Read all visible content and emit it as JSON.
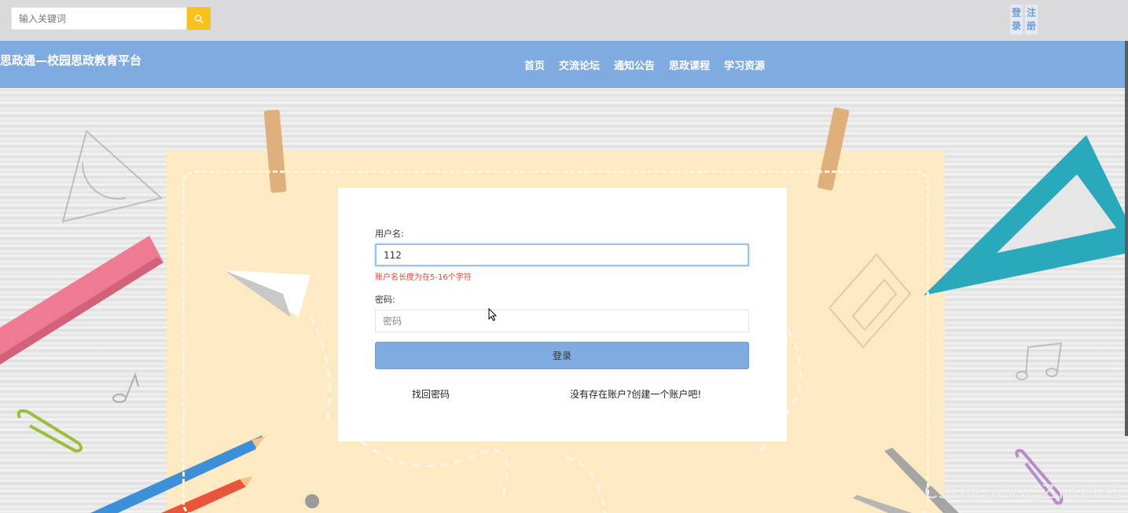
{
  "search": {
    "placeholder": "输入关键词",
    "icon": "search-icon"
  },
  "auth": {
    "login": [
      "登",
      "录"
    ],
    "register": [
      "注",
      "册"
    ]
  },
  "nav": {
    "site_title": "思政通—校园思政教育平台",
    "items": [
      "首页",
      "交流论坛",
      "通知公告",
      "思政课程",
      "学习资源"
    ]
  },
  "form": {
    "username_label": "用户名:",
    "username_value": "112",
    "username_error": "账户名长度为在5-16个字符",
    "password_label": "密码:",
    "password_placeholder": "密码",
    "login_button": "登录",
    "forgot_link": "找回密码",
    "register_link": "没有存在账户?创建一个账户吧!"
  },
  "watermark": "CSDN @VX_ZYKJ985",
  "colors": {
    "accent": "#80abe0",
    "search_button": "#f7c21b",
    "error": "#e0463c",
    "paper": "#fde9c2"
  }
}
